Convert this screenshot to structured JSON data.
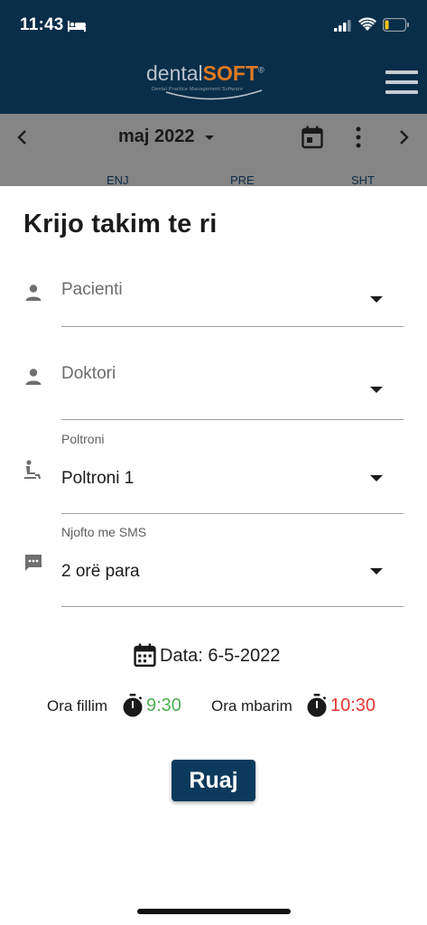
{
  "status_bar": {
    "time": "11:43",
    "icons": [
      "bed-icon",
      "signal-icon",
      "wifi-icon",
      "battery-icon"
    ]
  },
  "header": {
    "logo_primary": "dental",
    "logo_accent": "SOFT",
    "logo_mark": "®",
    "logo_tagline": "Dental Practice Management Software",
    "menu_icon": "hamburger-menu-icon"
  },
  "calendar": {
    "month": "maj 2022",
    "days": [
      "ENJ",
      "PRE",
      "SHT"
    ],
    "icons": [
      "chevron-left-icon",
      "dropdown-caret-icon",
      "calendar-today-icon",
      "more-vert-icon",
      "chevron-right-icon"
    ]
  },
  "form": {
    "title": "Krijo takim te ri",
    "patient": {
      "placeholder": "Pacienti",
      "icon": "person-icon"
    },
    "doctor": {
      "placeholder": "Doktori",
      "icon": "person-icon"
    },
    "chair": {
      "label": "Poltroni",
      "value": "Poltroni 1",
      "icon": "chair-icon"
    },
    "sms": {
      "label": "Njofto me SMS",
      "value": "2 orë para",
      "icon": "sms-icon"
    },
    "date_label": "Data: 6-5-2022",
    "start_label": "Ora fillim",
    "start_time": "9:30",
    "end_label": "Ora mbarim",
    "end_time": "10:30",
    "save_label": "Ruaj"
  },
  "colors": {
    "header_bg": "#082e4a",
    "overlay_bg": "#858585",
    "start_time": "#4caf50",
    "end_time": "#e53935",
    "button_bg": "#0b3a5c",
    "logo_accent": "#e07a22"
  }
}
